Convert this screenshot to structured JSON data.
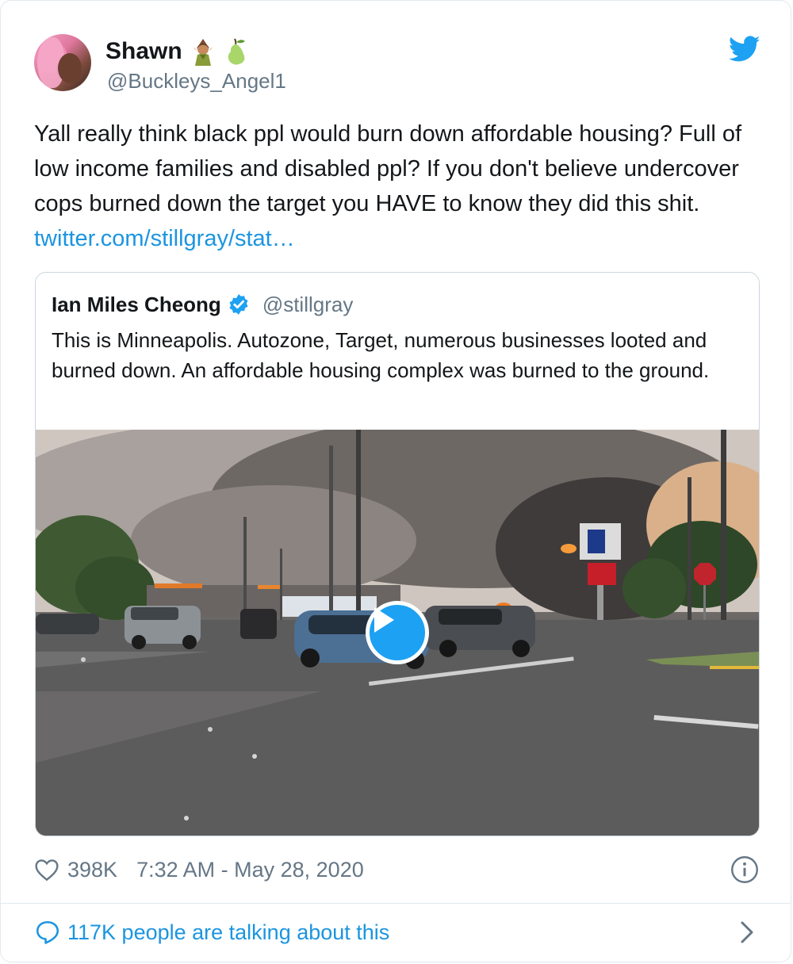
{
  "author": {
    "display_name": "Shawn",
    "handle": "@Buckleys_Angel1",
    "emojis": [
      "woman-elf-emoji",
      "pear-emoji"
    ]
  },
  "tweet": {
    "text": "Yall really think black ppl would burn down affordable housing? Full of low income families and disabled ppl? If you don't believe undercover cops burned down the target you HAVE to know they did this shit. ",
    "link": "twitter.com/stillgray/stat…"
  },
  "quoted_tweet": {
    "display_name": "Ian Miles Cheong",
    "verified": true,
    "handle": "@stillgray",
    "text": "This is Minneapolis. Autozone, Target, numerous businesses looted and burned down. An affordable housing complex was burned to the ground.",
    "media": {
      "type": "video",
      "icon": "play-icon"
    }
  },
  "footer": {
    "likes": "398K",
    "timestamp": "7:32 AM - May 28, 2020",
    "talking": "117K people are talking about this"
  },
  "colors": {
    "accent": "#1da1f2",
    "link": "#1b95e0",
    "secondary_text": "#657786",
    "border": "#e1e8ed"
  }
}
